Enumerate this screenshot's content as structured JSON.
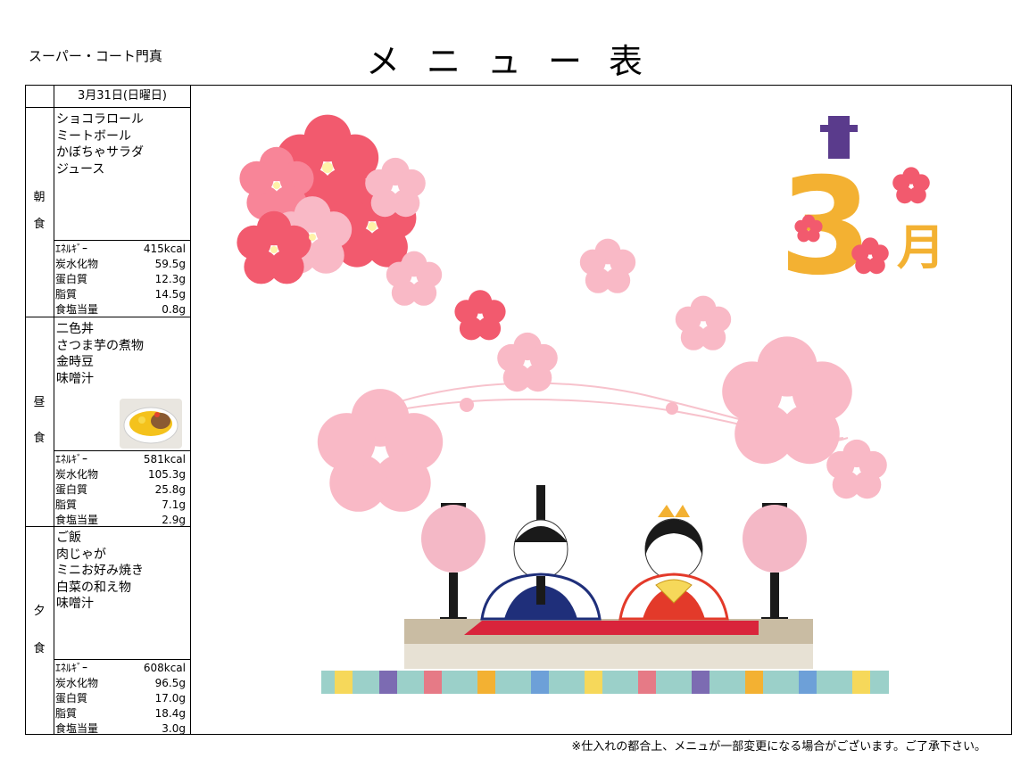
{
  "header": {
    "facility": "スーパー・コート門真",
    "title": "メニュー表"
  },
  "date": "3月31日(日曜日)",
  "meals": [
    {
      "label_top": "朝",
      "label_bottom": "食",
      "items": [
        "ショコラロール",
        "ミートボール",
        "かぼちゃサラダ",
        "ジュース"
      ],
      "nutrition": [
        {
          "name": "ｴﾈﾙｷﾞｰ",
          "value": "415kcal"
        },
        {
          "name": "炭水化物",
          "value": "59.5g"
        },
        {
          "name": "蛋白質",
          "value": "12.3g"
        },
        {
          "name": "脂質",
          "value": "14.5g"
        },
        {
          "name": "食塩当量",
          "value": "0.8g"
        }
      ]
    },
    {
      "label_top": "昼",
      "label_bottom": "食",
      "items": [
        "二色丼",
        "さつま芋の煮物",
        "金時豆",
        "味噌汁"
      ],
      "nutrition": [
        {
          "name": "ｴﾈﾙｷﾞｰ",
          "value": "581kcal"
        },
        {
          "name": "炭水化物",
          "value": "105.3g"
        },
        {
          "name": "蛋白質",
          "value": "25.8g"
        },
        {
          "name": "脂質",
          "value": "7.1g"
        },
        {
          "name": "食塩当量",
          "value": "2.9g"
        }
      ]
    },
    {
      "label_top": "夕",
      "label_bottom": "食",
      "items": [
        "ご飯",
        "肉じゃが",
        "ミニお好み焼き",
        "白菜の和え物",
        "味噌汁"
      ],
      "nutrition": [
        {
          "name": "ｴﾈﾙｷﾞｰ",
          "value": "608kcal"
        },
        {
          "name": "炭水化物",
          "value": "96.5g"
        },
        {
          "name": "蛋白質",
          "value": "17.0g"
        },
        {
          "name": "脂質",
          "value": "18.4g"
        },
        {
          "name": "食塩当量",
          "value": "3.0g"
        }
      ]
    }
  ],
  "illustration": {
    "month_number": "3",
    "month_kanji": "月"
  },
  "footnote": "※仕入れの都合上、メニュが一部変更になる場合がございます。ご了承下さい。",
  "colors": {
    "plum_red": "#f25a6e",
    "plum_pink": "#f9b9c6",
    "gold": "#f3b132",
    "navy": "#1f2f7a",
    "red_robe": "#e33a2a"
  }
}
